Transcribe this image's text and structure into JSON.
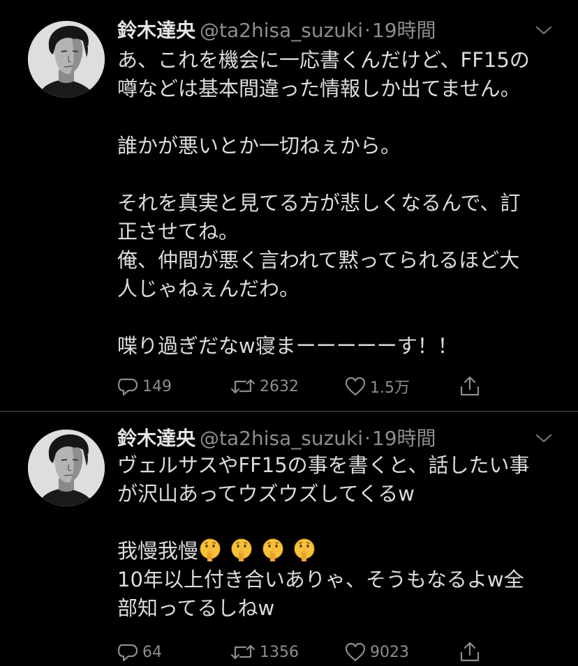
{
  "colors": {
    "background": "#000000",
    "text": "#dcdcdc",
    "secondary": "#8e8e8e",
    "divider": "#2b2b2b"
  },
  "tweets": [
    {
      "author": {
        "name": "鈴木達央",
        "handle": "@ta2hisa_suzuki",
        "separator": "·",
        "time": "19時間"
      },
      "body_lines": [
        "あ、これを機会に一応書くんだけど、FF15の",
        "噂などは基本間違った情報しか出てません。",
        "",
        "誰かが悪いとか一切ねぇから。",
        "",
        "それを真実と見てる方が悲しくなるんで、訂",
        "正させてね。",
        "俺、仲間が悪く言われて黙ってられるほど大",
        "人じゃねぇんだわ。",
        "",
        "喋り過ぎだなw寝まーーーーーす！！"
      ],
      "stats": {
        "replies": "149",
        "retweets": "2632",
        "likes": "1.5万"
      },
      "icons": {
        "reply": "reply-icon",
        "retweet": "retweet-icon",
        "like": "heart-icon",
        "share": "share-icon",
        "menu": "chevron-down-icon"
      }
    },
    {
      "author": {
        "name": "鈴木達央",
        "handle": "@ta2hisa_suzuki",
        "separator": "·",
        "time": "19時間"
      },
      "body_lines": [
        "ヴェルサスやFF15の事を書くと、話したい事",
        "が沢山あってウズウズしてくるw",
        "",
        "我慢我慢",
        "10年以上付き合いありゃ、そうもなるよw全",
        "部知ってるしねw"
      ],
      "emoji_line": {
        "text": "我慢我慢",
        "emoji": [
          "shushing-face-emoji",
          "shushing-face-emoji",
          "shushing-face-emoji",
          "shushing-face-emoji"
        ]
      },
      "stats": {
        "replies": "64",
        "retweets": "1356",
        "likes": "9023"
      },
      "icons": {
        "reply": "reply-icon",
        "retweet": "retweet-icon",
        "like": "heart-icon",
        "share": "share-icon",
        "menu": "chevron-down-icon"
      }
    }
  ]
}
